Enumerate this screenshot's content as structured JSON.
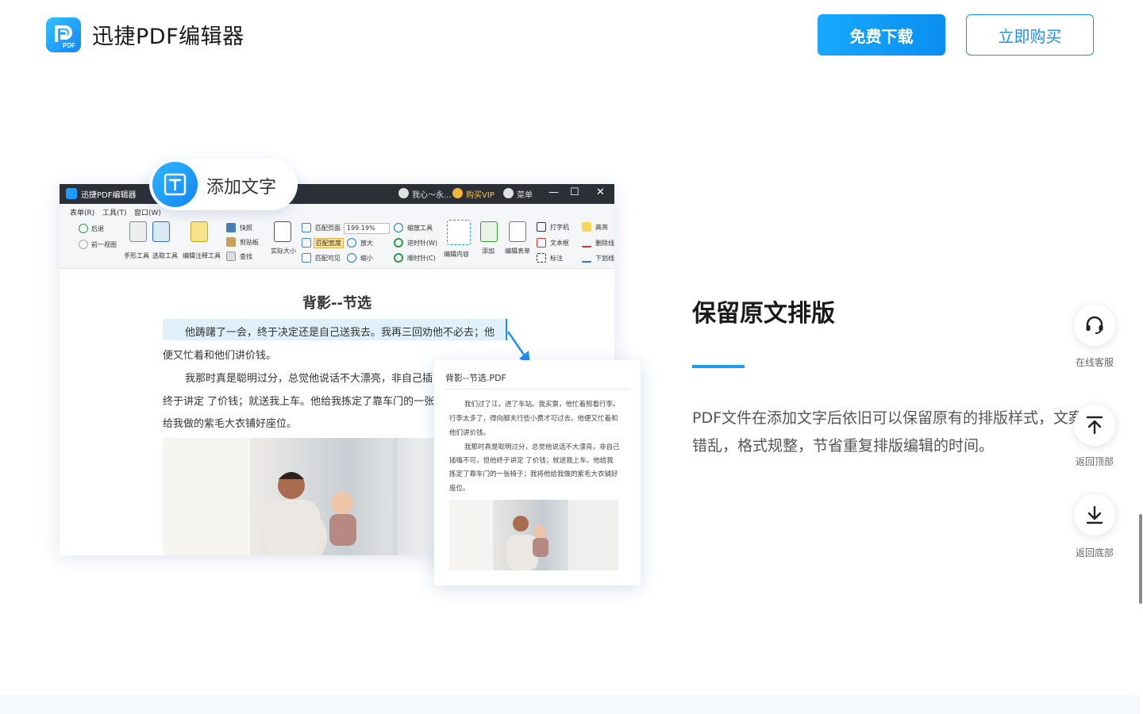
{
  "header": {
    "brand": "迅捷PDF编辑器",
    "logo_text": "PDF",
    "download_label": "免费下载",
    "buy_label": "立即购买",
    "accent": "#1a9cf0"
  },
  "mockup": {
    "badge_label": "添加文字",
    "title_bar": {
      "app_name": "迅捷PDF编辑器",
      "user": "我心～永...",
      "vip": "购买VIP",
      "menu": "菜单",
      "minimize": "—",
      "maximize": "☐",
      "close": "✕"
    },
    "menubar": [
      "表单(R)",
      "工具(T)",
      "窗口(W)"
    ],
    "toolbar": {
      "back": "后退",
      "prev_view": "前一视图",
      "hand_tool": "手形工具",
      "select_tool": "选取工具",
      "annot_tool": "编辑注释工具",
      "snapshot": "快照",
      "clipboard": "剪贴板",
      "find": "查找",
      "actual_size": "实际大小",
      "fit_page": "匹配页面",
      "fit_width": "匹配宽度",
      "fit_visible": "匹配可见",
      "zoom_value": "199.19%",
      "zoom_tool": "缩放工具",
      "zoom_in": "放大",
      "zoom_out": "缩小",
      "ccw": "逆时针(W)",
      "cw": "顺时针(C)",
      "edit_content": "编辑内容",
      "add": "添加",
      "edit_form": "编辑表单",
      "typewriter": "打字机",
      "textbox": "文本框",
      "callout": "标注",
      "highlight": "高亮",
      "strike": "删除线",
      "underline": "下划线"
    },
    "document": {
      "title": "背影--节选",
      "lines": [
        "他踌躇了一会，终于决定还是自己送我去。我再三回劝他不必去；他",
        "便又忙着和他们讲价钱。",
        "我那时真是聪明过分，总觉他说话不大漂亮，非自己插",
        "终于讲定 了价钱；就送我上车。他给我拣定了靠车门的一张",
        "给我做的紫毛大衣铺好座位。"
      ]
    },
    "card": {
      "title": "背影--节选.PDF",
      "lines": [
        "我们过了江，进了车站。我买票，他忙着照看行李。",
        "行李太多了，得向脚夫行些小费才可过去。他便又忙着和",
        "他们讲价钱。",
        "我那时真是聪明过分，总觉他说话不大漂亮，非自己",
        "插嘴不可，但他终于讲定 了价钱；就送我上车。他给我",
        "拣定了靠车门的一张椅子；我将他给我做的紫毛大衣铺好",
        "座位。"
      ]
    }
  },
  "feature": {
    "title": "保留原文排版",
    "description": "PDF文件在添加文字后依旧可以保留原有的排版样式，文案不错乱，格式规整，节省重复排版编辑的时间。"
  },
  "side": {
    "service": "在线客服",
    "top": "返回顶部",
    "bottom": "返回底部"
  }
}
